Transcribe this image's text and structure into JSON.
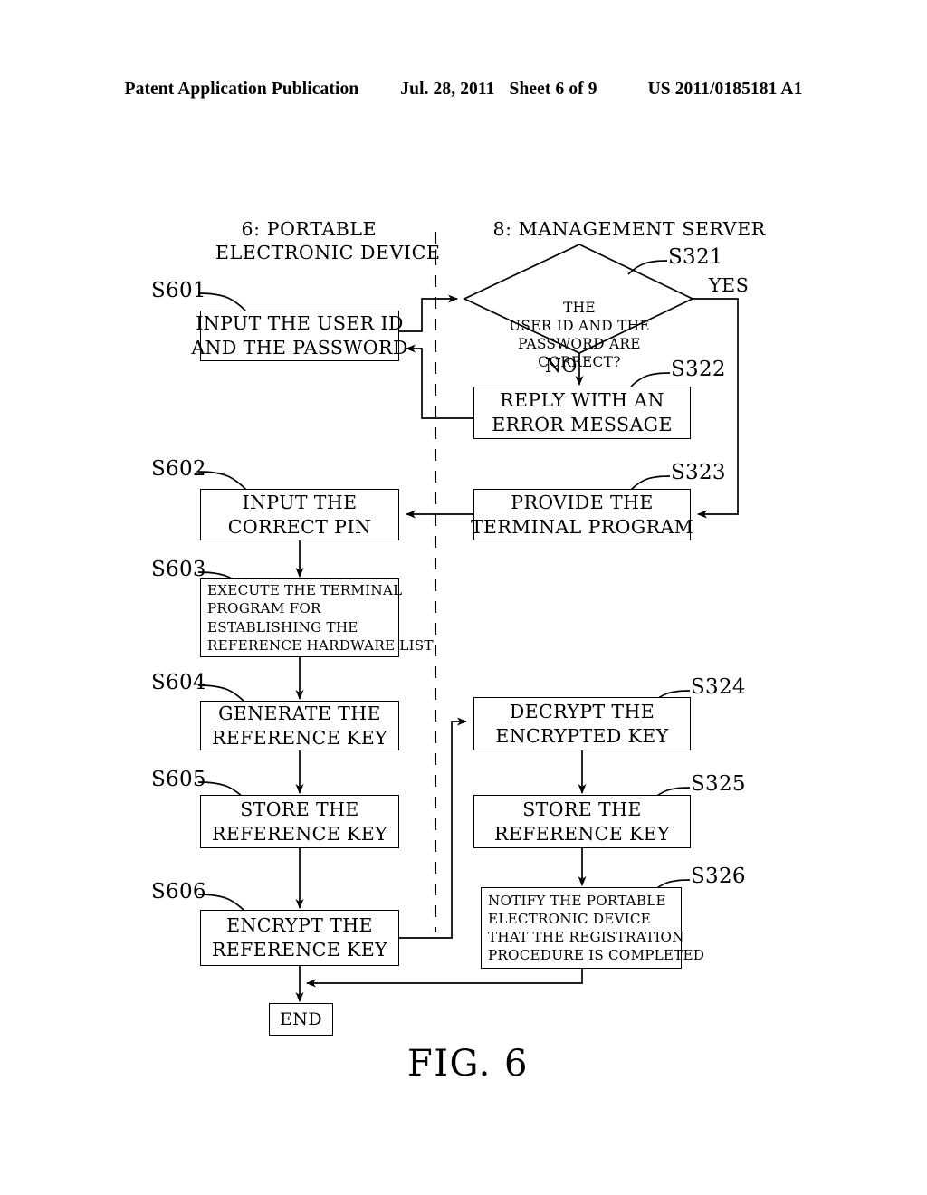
{
  "header": {
    "publication": "Patent Application Publication",
    "date": "Jul. 28, 2011",
    "sheet": "Sheet 6 of 9",
    "patent_number": "US 2011/0185181 A1"
  },
  "figure": {
    "caption": "FIG. 6",
    "columns": [
      {
        "id": "left",
        "label": "6: PORTABLE\nELECTRONIC DEVICE"
      },
      {
        "id": "right",
        "label": "8: MANAGEMENT SERVER"
      }
    ]
  },
  "branches": {
    "yes": "YES",
    "no": "NO"
  },
  "nodes": {
    "s601": {
      "tag": "S601",
      "text": "INPUT THE USER ID\nAND THE PASSWORD"
    },
    "s321": {
      "tag": "S321",
      "text": "THE\nUSER ID AND THE\nPASSWORD ARE\nCORRECT?"
    },
    "s322": {
      "tag": "S322",
      "text": "REPLY WITH AN\nERROR MESSAGE"
    },
    "s323": {
      "tag": "S323",
      "text": "PROVIDE THE\nTERMINAL PROGRAM"
    },
    "s602": {
      "tag": "S602",
      "text": "INPUT THE\nCORRECT PIN"
    },
    "s603": {
      "tag": "S603",
      "text": "EXECUTE THE TERMINAL\nPROGRAM FOR\nESTABLISHING THE\nREFERENCE HARDWARE LIST"
    },
    "s604": {
      "tag": "S604",
      "text": "GENERATE THE\nREFERENCE KEY"
    },
    "s324": {
      "tag": "S324",
      "text": "DECRYPT THE\nENCRYPTED KEY"
    },
    "s605": {
      "tag": "S605",
      "text": "STORE THE\nREFERENCE KEY"
    },
    "s325": {
      "tag": "S325",
      "text": "STORE THE\nREFERENCE KEY"
    },
    "s606": {
      "tag": "S606",
      "text": "ENCRYPT THE\nREFERENCE KEY"
    },
    "s326": {
      "tag": "S326",
      "text": "NOTIFY THE PORTABLE\nELECTRONIC DEVICE\nTHAT THE REGISTRATION\nPROCEDURE IS COMPLETED"
    },
    "end": {
      "tag": "",
      "text": "END"
    }
  }
}
